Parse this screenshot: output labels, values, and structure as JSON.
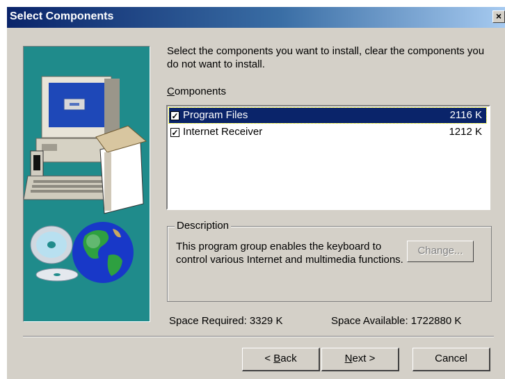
{
  "window": {
    "title": "Select Components",
    "close_glyph": "×"
  },
  "instructions": "Select the components you want to install, clear the components you do not want to install.",
  "components": {
    "label_accel": "C",
    "label_rest": "omponents",
    "items": [
      {
        "name": "Program Files",
        "size": "2116 K",
        "checked": true,
        "selected": true,
        "check_glyph": "✓"
      },
      {
        "name": "Internet Receiver",
        "size": "1212 K",
        "checked": true,
        "selected": false,
        "check_glyph": "✓"
      }
    ]
  },
  "description": {
    "legend": "Description",
    "text": "This program group enables the keyboard to control various Internet and multimedia functions.",
    "change_label": "Change..."
  },
  "space": {
    "required": "Space Required:  3329 K",
    "available": "Space Available:  1722880 K"
  },
  "buttons": {
    "back_pre": "< ",
    "back_accel": "B",
    "back_rest": "ack",
    "next_accel": "N",
    "next_rest": "ext >",
    "cancel": "Cancel"
  },
  "colors": {
    "title_bar_start": "#0a246a",
    "title_bar_end": "#a6caf0",
    "dialog_bg": "#d4d0c8",
    "art_bg": "#1f8b8b",
    "selection": "#0a246a"
  },
  "icons": [
    "close-icon",
    "computer-illustration",
    "cd-disc-icon",
    "globe-icon",
    "checkbox-icon"
  ]
}
